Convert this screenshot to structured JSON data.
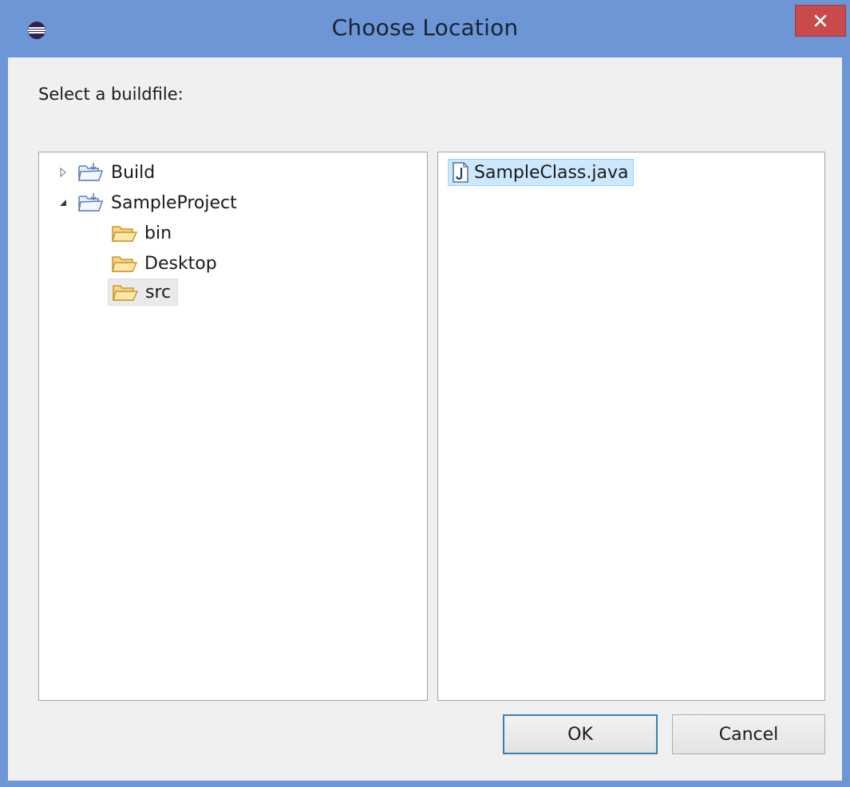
{
  "window": {
    "title": "Choose Location",
    "app_icon": "eclipse-icon",
    "close_icon": "close-icon"
  },
  "dialog": {
    "prompt": "Select a buildfile:"
  },
  "tree": {
    "items": [
      {
        "label": "Build",
        "expanded": false,
        "icon": "project-folder-icon"
      },
      {
        "label": "SampleProject",
        "expanded": true,
        "icon": "project-folder-icon"
      },
      {
        "label": "bin",
        "icon": "folder-icon"
      },
      {
        "label": "Desktop",
        "icon": "folder-icon"
      },
      {
        "label": "src",
        "icon": "folder-icon",
        "selected": true
      }
    ]
  },
  "files": {
    "items": [
      {
        "label": "SampleClass.java",
        "icon": "java-file-icon",
        "selected": true
      }
    ]
  },
  "buttons": {
    "ok": "OK",
    "cancel": "Cancel"
  },
  "colors": {
    "titlebar": "#6c96d6",
    "close": "#c94a4a",
    "selection": "#cce8ff",
    "focus_border": "#3c7fb1"
  }
}
